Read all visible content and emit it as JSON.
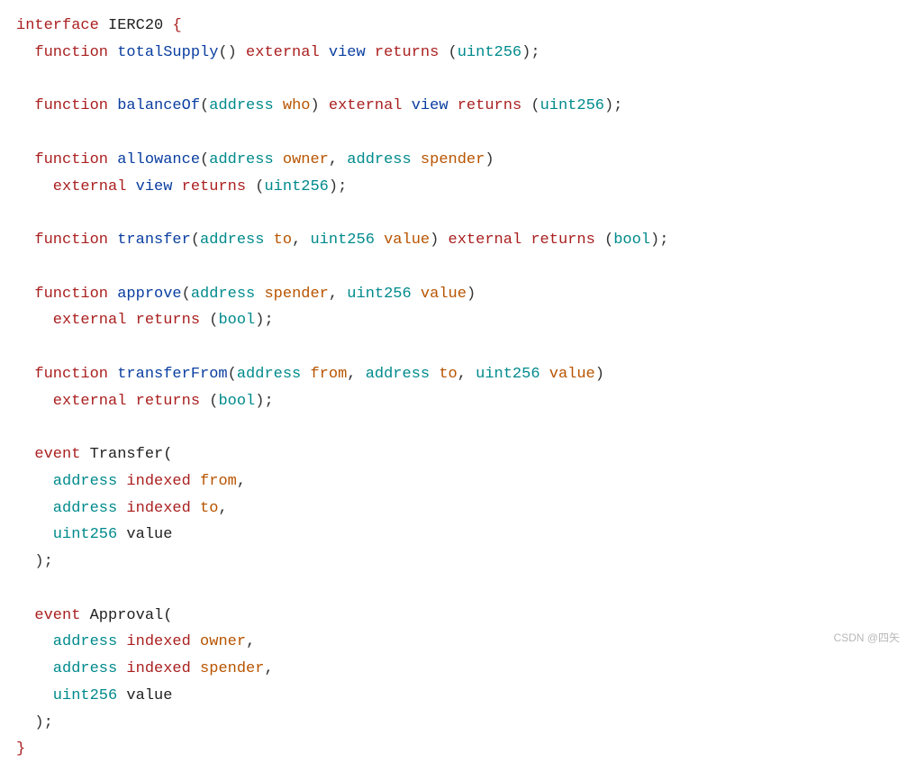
{
  "code": {
    "lines": [
      {
        "indent": 0,
        "tokens": [
          {
            "c": "kw-red",
            "t": "interface"
          },
          {
            "c": "punct",
            "t": " "
          },
          {
            "c": "name-dark",
            "t": "IERC20"
          },
          {
            "c": "punct",
            "t": " "
          },
          {
            "c": "kw-red",
            "t": "{"
          }
        ]
      },
      {
        "indent": 1,
        "tokens": [
          {
            "c": "kw-red",
            "t": "function"
          },
          {
            "c": "punct",
            "t": " "
          },
          {
            "c": "kw-blue",
            "t": "totalSupply"
          },
          {
            "c": "punct",
            "t": "() "
          },
          {
            "c": "kw-red",
            "t": "external"
          },
          {
            "c": "punct",
            "t": " "
          },
          {
            "c": "kw-blue",
            "t": "view"
          },
          {
            "c": "punct",
            "t": " "
          },
          {
            "c": "kw-red",
            "t": "returns"
          },
          {
            "c": "punct",
            "t": " ("
          },
          {
            "c": "type-teal",
            "t": "uint256"
          },
          {
            "c": "punct",
            "t": ");"
          }
        ]
      },
      {
        "blank": true
      },
      {
        "indent": 1,
        "tokens": [
          {
            "c": "kw-red",
            "t": "function"
          },
          {
            "c": "punct",
            "t": " "
          },
          {
            "c": "kw-blue",
            "t": "balanceOf"
          },
          {
            "c": "punct",
            "t": "("
          },
          {
            "c": "type-teal",
            "t": "address"
          },
          {
            "c": "punct",
            "t": " "
          },
          {
            "c": "param-orange",
            "t": "who"
          },
          {
            "c": "punct",
            "t": ") "
          },
          {
            "c": "kw-red",
            "t": "external"
          },
          {
            "c": "punct",
            "t": " "
          },
          {
            "c": "kw-blue",
            "t": "view"
          },
          {
            "c": "punct",
            "t": " "
          },
          {
            "c": "kw-red",
            "t": "returns"
          },
          {
            "c": "punct",
            "t": " ("
          },
          {
            "c": "type-teal",
            "t": "uint256"
          },
          {
            "c": "punct",
            "t": ");"
          }
        ]
      },
      {
        "blank": true
      },
      {
        "indent": 1,
        "tokens": [
          {
            "c": "kw-red",
            "t": "function"
          },
          {
            "c": "punct",
            "t": " "
          },
          {
            "c": "kw-blue",
            "t": "allowance"
          },
          {
            "c": "punct",
            "t": "("
          },
          {
            "c": "type-teal",
            "t": "address"
          },
          {
            "c": "punct",
            "t": " "
          },
          {
            "c": "param-orange",
            "t": "owner"
          },
          {
            "c": "punct",
            "t": ", "
          },
          {
            "c": "type-teal",
            "t": "address"
          },
          {
            "c": "punct",
            "t": " "
          },
          {
            "c": "param-orange",
            "t": "spender"
          },
          {
            "c": "punct",
            "t": ")"
          }
        ]
      },
      {
        "indent": 2,
        "tokens": [
          {
            "c": "kw-red",
            "t": "external"
          },
          {
            "c": "punct",
            "t": " "
          },
          {
            "c": "kw-blue",
            "t": "view"
          },
          {
            "c": "punct",
            "t": " "
          },
          {
            "c": "kw-red",
            "t": "returns"
          },
          {
            "c": "punct",
            "t": " ("
          },
          {
            "c": "type-teal",
            "t": "uint256"
          },
          {
            "c": "punct",
            "t": ");"
          }
        ]
      },
      {
        "blank": true
      },
      {
        "indent": 1,
        "tokens": [
          {
            "c": "kw-red",
            "t": "function"
          },
          {
            "c": "punct",
            "t": " "
          },
          {
            "c": "kw-blue",
            "t": "transfer"
          },
          {
            "c": "punct",
            "t": "("
          },
          {
            "c": "type-teal",
            "t": "address"
          },
          {
            "c": "punct",
            "t": " "
          },
          {
            "c": "param-orange",
            "t": "to"
          },
          {
            "c": "punct",
            "t": ", "
          },
          {
            "c": "type-teal",
            "t": "uint256"
          },
          {
            "c": "punct",
            "t": " "
          },
          {
            "c": "param-orange",
            "t": "value"
          },
          {
            "c": "punct",
            "t": ") "
          },
          {
            "c": "kw-red",
            "t": "external"
          },
          {
            "c": "punct",
            "t": " "
          },
          {
            "c": "kw-red",
            "t": "returns"
          },
          {
            "c": "punct",
            "t": " ("
          },
          {
            "c": "type-teal",
            "t": "bool"
          },
          {
            "c": "punct",
            "t": ");"
          }
        ]
      },
      {
        "blank": true
      },
      {
        "indent": 1,
        "tokens": [
          {
            "c": "kw-red",
            "t": "function"
          },
          {
            "c": "punct",
            "t": " "
          },
          {
            "c": "kw-blue",
            "t": "approve"
          },
          {
            "c": "punct",
            "t": "("
          },
          {
            "c": "type-teal",
            "t": "address"
          },
          {
            "c": "punct",
            "t": " "
          },
          {
            "c": "param-orange",
            "t": "spender"
          },
          {
            "c": "punct",
            "t": ", "
          },
          {
            "c": "type-teal",
            "t": "uint256"
          },
          {
            "c": "punct",
            "t": " "
          },
          {
            "c": "param-orange",
            "t": "value"
          },
          {
            "c": "punct",
            "t": ")"
          }
        ]
      },
      {
        "indent": 2,
        "tokens": [
          {
            "c": "kw-red",
            "t": "external"
          },
          {
            "c": "punct",
            "t": " "
          },
          {
            "c": "kw-red",
            "t": "returns"
          },
          {
            "c": "punct",
            "t": " ("
          },
          {
            "c": "type-teal",
            "t": "bool"
          },
          {
            "c": "punct",
            "t": ");"
          }
        ]
      },
      {
        "blank": true
      },
      {
        "indent": 1,
        "tokens": [
          {
            "c": "kw-red",
            "t": "function"
          },
          {
            "c": "punct",
            "t": " "
          },
          {
            "c": "kw-blue",
            "t": "transferFrom"
          },
          {
            "c": "punct",
            "t": "("
          },
          {
            "c": "type-teal",
            "t": "address"
          },
          {
            "c": "punct",
            "t": " "
          },
          {
            "c": "param-orange",
            "t": "from"
          },
          {
            "c": "punct",
            "t": ", "
          },
          {
            "c": "type-teal",
            "t": "address"
          },
          {
            "c": "punct",
            "t": " "
          },
          {
            "c": "param-orange",
            "t": "to"
          },
          {
            "c": "punct",
            "t": ", "
          },
          {
            "c": "type-teal",
            "t": "uint256"
          },
          {
            "c": "punct",
            "t": " "
          },
          {
            "c": "param-orange",
            "t": "value"
          },
          {
            "c": "punct",
            "t": ")"
          }
        ]
      },
      {
        "indent": 2,
        "tokens": [
          {
            "c": "kw-red",
            "t": "external"
          },
          {
            "c": "punct",
            "t": " "
          },
          {
            "c": "kw-red",
            "t": "returns"
          },
          {
            "c": "punct",
            "t": " ("
          },
          {
            "c": "type-teal",
            "t": "bool"
          },
          {
            "c": "punct",
            "t": ");"
          }
        ]
      },
      {
        "blank": true
      },
      {
        "indent": 1,
        "tokens": [
          {
            "c": "kw-red",
            "t": "event"
          },
          {
            "c": "punct",
            "t": " "
          },
          {
            "c": "name-dark",
            "t": "Transfer("
          }
        ]
      },
      {
        "indent": 2,
        "tokens": [
          {
            "c": "type-teal",
            "t": "address"
          },
          {
            "c": "punct",
            "t": " "
          },
          {
            "c": "kw-red",
            "t": "indexed"
          },
          {
            "c": "punct",
            "t": " "
          },
          {
            "c": "param-orange",
            "t": "from"
          },
          {
            "c": "punct",
            "t": ","
          }
        ]
      },
      {
        "indent": 2,
        "tokens": [
          {
            "c": "type-teal",
            "t": "address"
          },
          {
            "c": "punct",
            "t": " "
          },
          {
            "c": "kw-red",
            "t": "indexed"
          },
          {
            "c": "punct",
            "t": " "
          },
          {
            "c": "param-orange",
            "t": "to"
          },
          {
            "c": "punct",
            "t": ","
          }
        ]
      },
      {
        "indent": 2,
        "tokens": [
          {
            "c": "type-teal",
            "t": "uint256"
          },
          {
            "c": "punct",
            "t": " "
          },
          {
            "c": "name-dark",
            "t": "value"
          }
        ]
      },
      {
        "indent": 1,
        "tokens": [
          {
            "c": "punct",
            "t": ");"
          }
        ]
      },
      {
        "blank": true
      },
      {
        "indent": 1,
        "tokens": [
          {
            "c": "kw-red",
            "t": "event"
          },
          {
            "c": "punct",
            "t": " "
          },
          {
            "c": "name-dark",
            "t": "Approval("
          }
        ]
      },
      {
        "indent": 2,
        "tokens": [
          {
            "c": "type-teal",
            "t": "address"
          },
          {
            "c": "punct",
            "t": " "
          },
          {
            "c": "kw-red",
            "t": "indexed"
          },
          {
            "c": "punct",
            "t": " "
          },
          {
            "c": "param-orange",
            "t": "owner"
          },
          {
            "c": "punct",
            "t": ","
          }
        ]
      },
      {
        "indent": 2,
        "tokens": [
          {
            "c": "type-teal",
            "t": "address"
          },
          {
            "c": "punct",
            "t": " "
          },
          {
            "c": "kw-red",
            "t": "indexed"
          },
          {
            "c": "punct",
            "t": " "
          },
          {
            "c": "param-orange",
            "t": "spender"
          },
          {
            "c": "punct",
            "t": ","
          }
        ]
      },
      {
        "indent": 2,
        "tokens": [
          {
            "c": "type-teal",
            "t": "uint256"
          },
          {
            "c": "punct",
            "t": " "
          },
          {
            "c": "name-dark",
            "t": "value"
          }
        ]
      },
      {
        "indent": 1,
        "tokens": [
          {
            "c": "punct",
            "t": ");"
          }
        ]
      },
      {
        "indent": 0,
        "tokens": [
          {
            "c": "kw-red",
            "t": "}"
          }
        ]
      }
    ]
  },
  "watermark": "CSDN @四矢"
}
